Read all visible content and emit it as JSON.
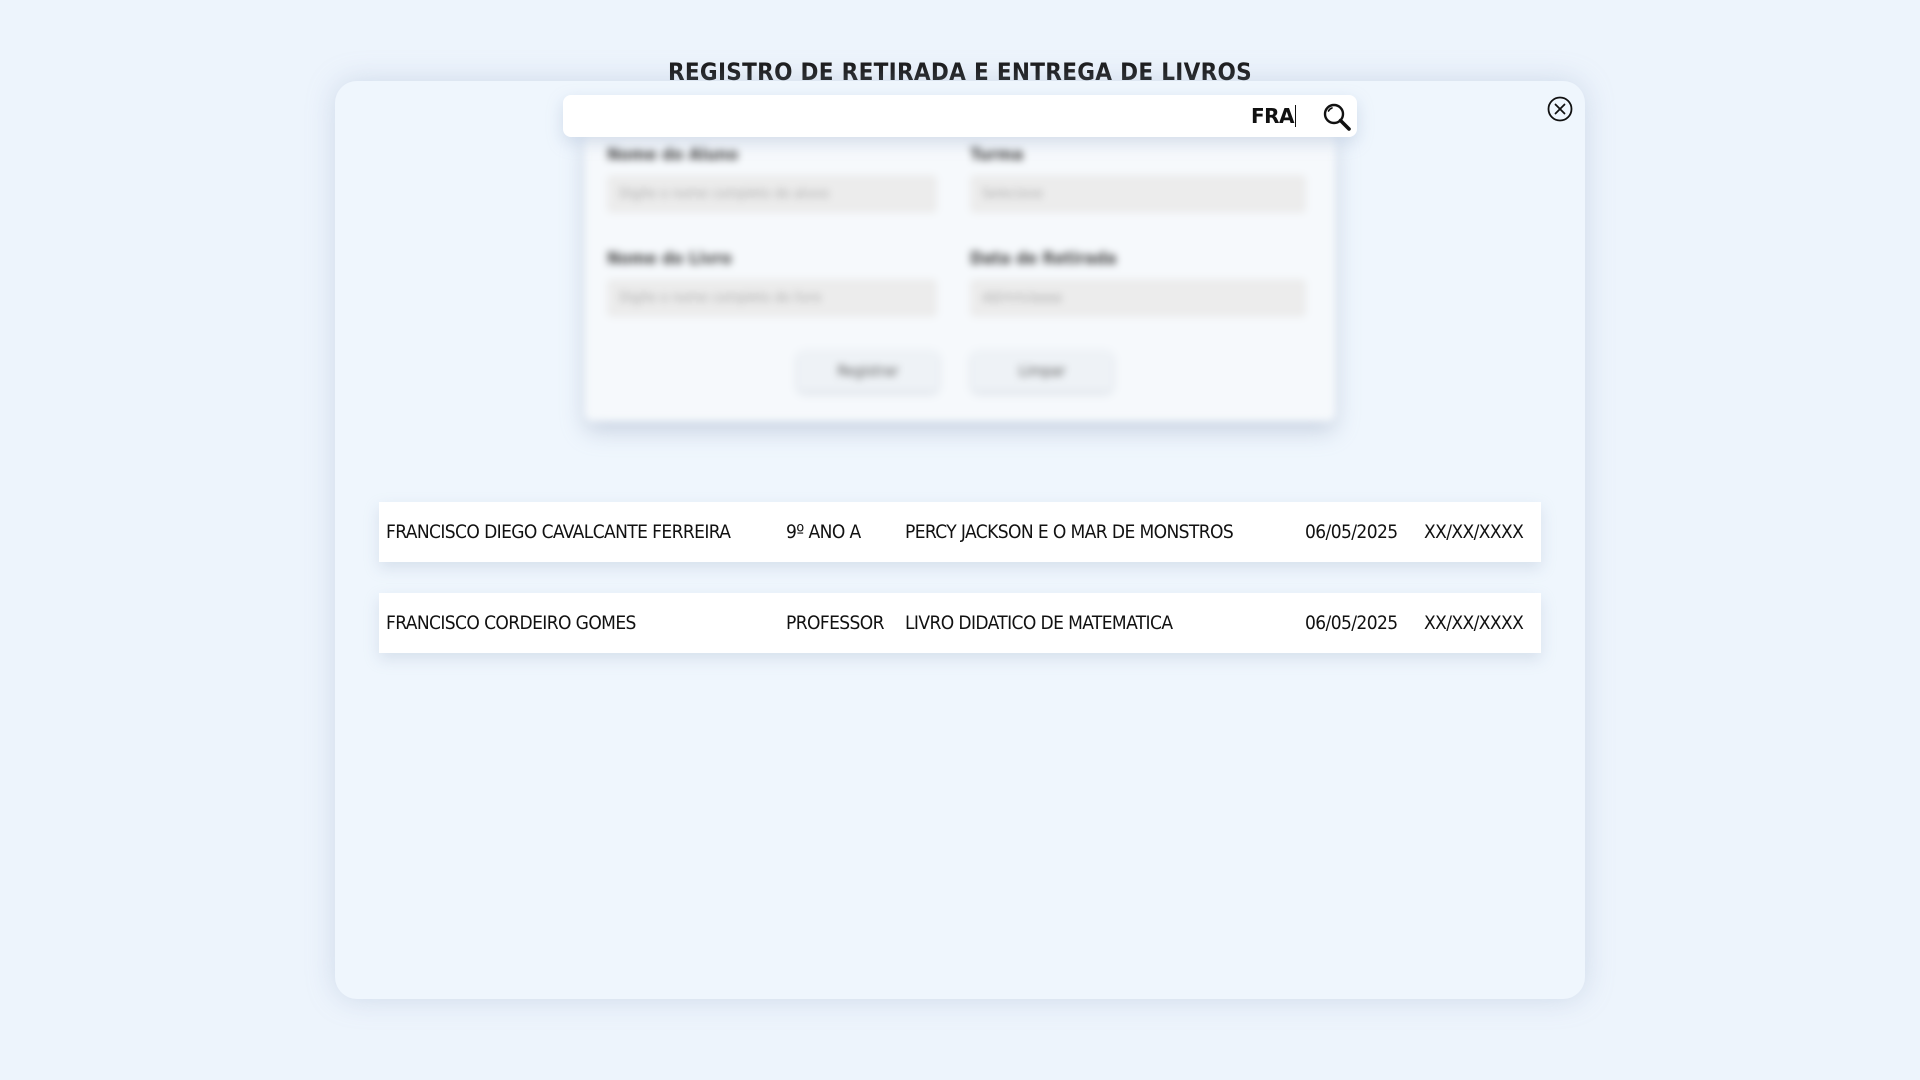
{
  "page": {
    "title": "REGISTRO DE RETIRADA E ENTREGA DE LIVROS"
  },
  "search": {
    "value": "FRA",
    "icon": "search-icon"
  },
  "modal": {
    "close_icon": "close-icon"
  },
  "form": {
    "student_label": "Nome do Aluno",
    "student_placeholder": "Digite o nome completo do aluno",
    "class_label": "Turma",
    "class_value": "Selecione",
    "book_label": "Nome do Livro",
    "book_placeholder": "Digite o nome completo do livro",
    "date_label": "Data de Retirada",
    "date_value": "dd/mm/aaaa",
    "register_label": "Registrar",
    "clear_label": "Limpar"
  },
  "results": [
    {
      "name": "FRANCISCO DIEGO CAVALCANTE FERREIRA",
      "class": "9º ANO A",
      "book": "PERCY JACKSON E O MAR DE MONSTROS",
      "checkout_date": "06/05/2025",
      "return_date": "XX/XX/XXXX"
    },
    {
      "name": "FRANCISCO CORDEIRO GOMES",
      "class": "PROFESSOR",
      "book": "LIVRO DIDATICO DE MATEMATICA",
      "checkout_date": "06/05/2025",
      "return_date": "XX/XX/XXXX"
    }
  ]
}
